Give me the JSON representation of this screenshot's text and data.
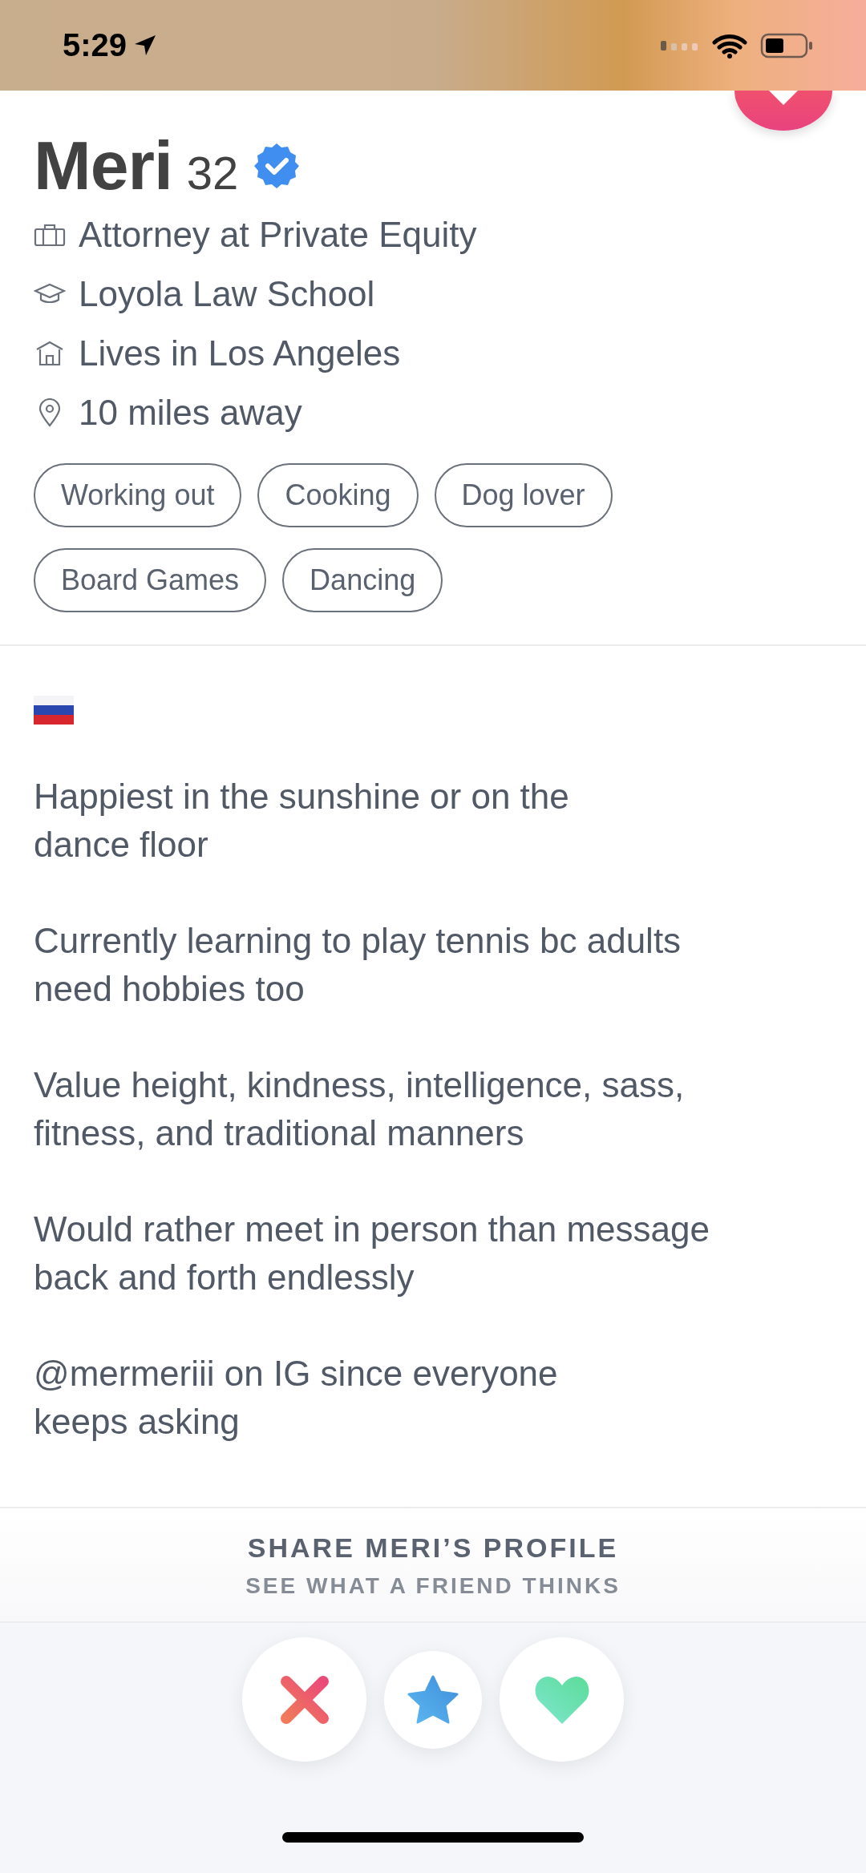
{
  "status_bar": {
    "time": "5:29"
  },
  "profile": {
    "name": "Meri",
    "age": "32",
    "verified": true,
    "details": [
      {
        "kind": "job",
        "text": "Attorney at Private Equity"
      },
      {
        "kind": "school",
        "text": "Loyola Law School"
      },
      {
        "kind": "home",
        "text": "Lives in Los Angeles"
      },
      {
        "kind": "distance",
        "text": "10 miles away"
      }
    ],
    "interests": [
      "Working out",
      "Cooking",
      "Dog lover",
      "Board Games",
      "Dancing"
    ]
  },
  "bio": [
    "Happiest in the sunshine or on the\ndance floor",
    "Currently learning to play tennis bc adults\nneed hobbies too",
    "Value height, kindness, intelligence, sass,\nfitness, and traditional manners",
    "Would rather meet in person than message\nback and forth endlessly",
    "@mermeriii on IG since everyone\nkeeps asking"
  ],
  "share": {
    "title": "SHARE MERI’S PROFILE",
    "subtitle": "SEE WHAT A FRIEND THINKS"
  },
  "actions": [
    {
      "kind": "nope"
    },
    {
      "kind": "super_like"
    },
    {
      "kind": "like"
    }
  ]
}
